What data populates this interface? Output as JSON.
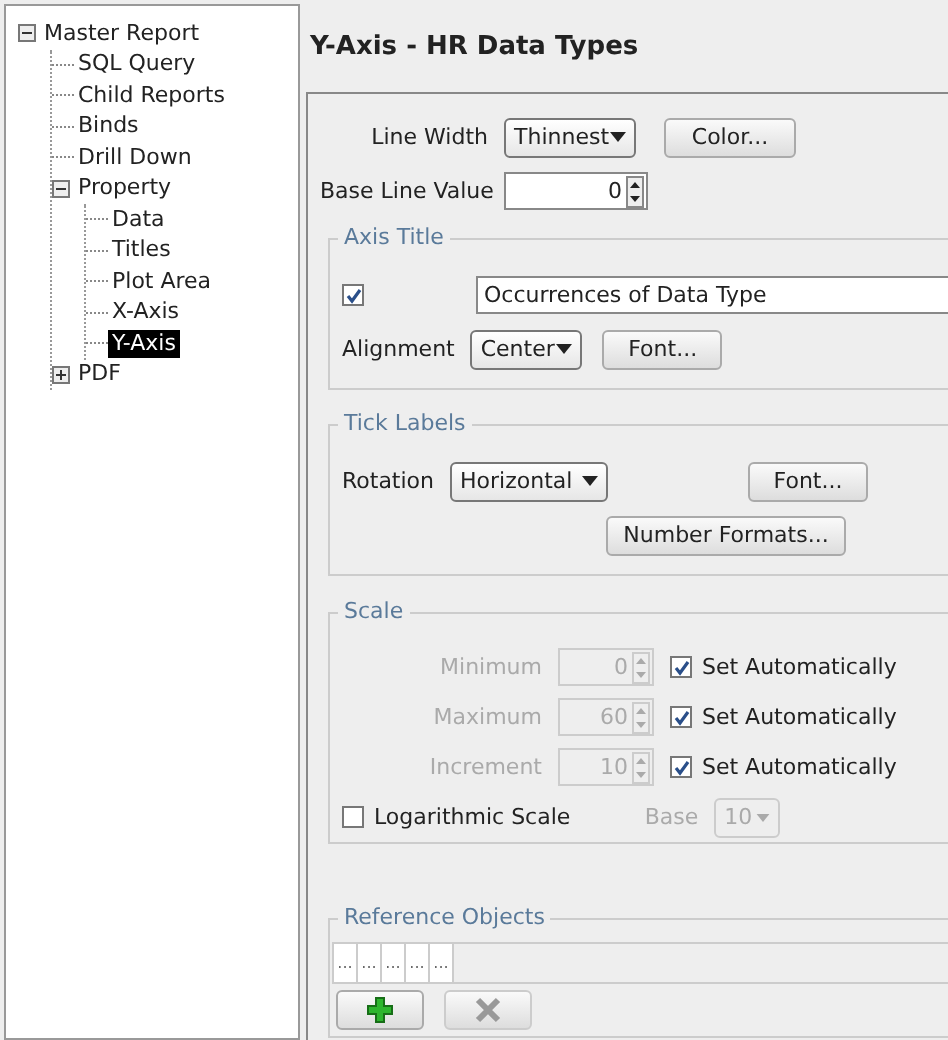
{
  "tree": [
    {
      "label": "Master Report",
      "selected": false,
      "expanded": true,
      "children": [
        {
          "label": "SQL Query",
          "selected": false
        },
        {
          "label": "Child Reports",
          "selected": false
        },
        {
          "label": "Binds",
          "selected": false
        },
        {
          "label": "Drill Down",
          "selected": false
        },
        {
          "label": "Property",
          "selected": false,
          "expanded": true,
          "children": [
            {
              "label": "Data",
              "selected": false
            },
            {
              "label": "Titles",
              "selected": false
            },
            {
              "label": "Plot Area",
              "selected": false
            },
            {
              "label": "X-Axis",
              "selected": false
            },
            {
              "label": "Y-Axis",
              "selected": true
            }
          ]
        },
        {
          "label": "PDF",
          "selected": false,
          "expanded": false
        }
      ]
    }
  ],
  "title": "Y-Axis - HR Data Types",
  "line_width": {
    "label": "Line Width",
    "value": "Thinnest"
  },
  "color_button": "Color...",
  "base_line": {
    "label": "Base Line Value",
    "value": "0"
  },
  "axis_title": {
    "legend": "Axis Title",
    "checked": true,
    "value": "Occurrences of Data Type",
    "alignment_label": "Alignment",
    "alignment": "Center",
    "font_button": "Font..."
  },
  "tick_labels": {
    "legend": "Tick Labels",
    "rotation_label": "Rotation",
    "rotation": "Horizontal",
    "font_button": "Font...",
    "number_formats_button": "Number Formats..."
  },
  "scale": {
    "legend": "Scale",
    "rows": [
      {
        "label": "Minimum",
        "value": "0",
        "disabled": true,
        "auto_label": "Set Automatically",
        "auto_checked": true
      },
      {
        "label": "Maximum",
        "value": "60",
        "disabled": true,
        "auto_label": "Set Automatically",
        "auto_checked": true
      },
      {
        "label": "Increment",
        "value": "10",
        "disabled": true,
        "auto_label": "Set Automatically",
        "auto_checked": true
      }
    ],
    "logarithmic": {
      "label": "Logarithmic Scale",
      "checked": false
    },
    "base": {
      "label": "Base",
      "value": "10",
      "disabled": true
    }
  },
  "reference_objects": {
    "legend": "Reference Objects",
    "columns": [
      "...",
      "...",
      "...",
      "...",
      "..."
    ],
    "add_disabled": false,
    "delete_disabled": true
  }
}
